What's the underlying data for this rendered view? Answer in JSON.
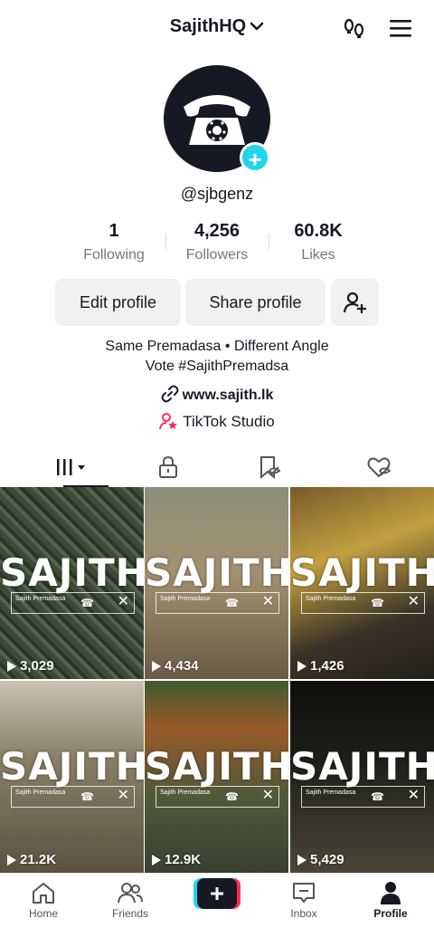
{
  "header": {
    "username": "SajithHQ"
  },
  "profile": {
    "handle": "@sjbgenz",
    "stats": [
      {
        "value": "1",
        "label": "Following"
      },
      {
        "value": "4,256",
        "label": "Followers"
      },
      {
        "value": "60.8K",
        "label": "Likes"
      }
    ],
    "buttons": {
      "edit": "Edit profile",
      "share": "Share profile"
    },
    "bio_line1": "Same Premadasa • Different Angle",
    "bio_line2": "Vote #SajithPremadsa",
    "link": "www.sajith.lk",
    "studio": "TikTok Studio"
  },
  "videos": [
    {
      "title": "SAJITH",
      "caption": "Sajith Premadasa",
      "views": "3,029",
      "color": "#3d4a37"
    },
    {
      "title": "SAJITH",
      "caption": "Sajith Premadasa",
      "views": "4,434",
      "color": "#7a6a4e"
    },
    {
      "title": "SAJITH",
      "caption": "Sajith Premadasa",
      "views": "1,426",
      "color": "#5a4a2c"
    },
    {
      "title": "SAJITH",
      "caption": "Sajith Premadasa",
      "views": "21.2K",
      "color": "#6b6450"
    },
    {
      "title": "SAJITH",
      "caption": "Sajith Premadasa",
      "views": "12.9K",
      "color": "#4f5a3a"
    },
    {
      "title": "SAJITH",
      "caption": "Sajith Premadasa",
      "views": "5,429",
      "color": "#2a2a22"
    }
  ],
  "nav": {
    "home": "Home",
    "friends": "Friends",
    "inbox": "Inbox",
    "profile": "Profile"
  },
  "colors": {
    "accent_cyan": "#20d5ec",
    "accent_red": "#fe2c55",
    "studio_pink": "#fe2c55"
  }
}
